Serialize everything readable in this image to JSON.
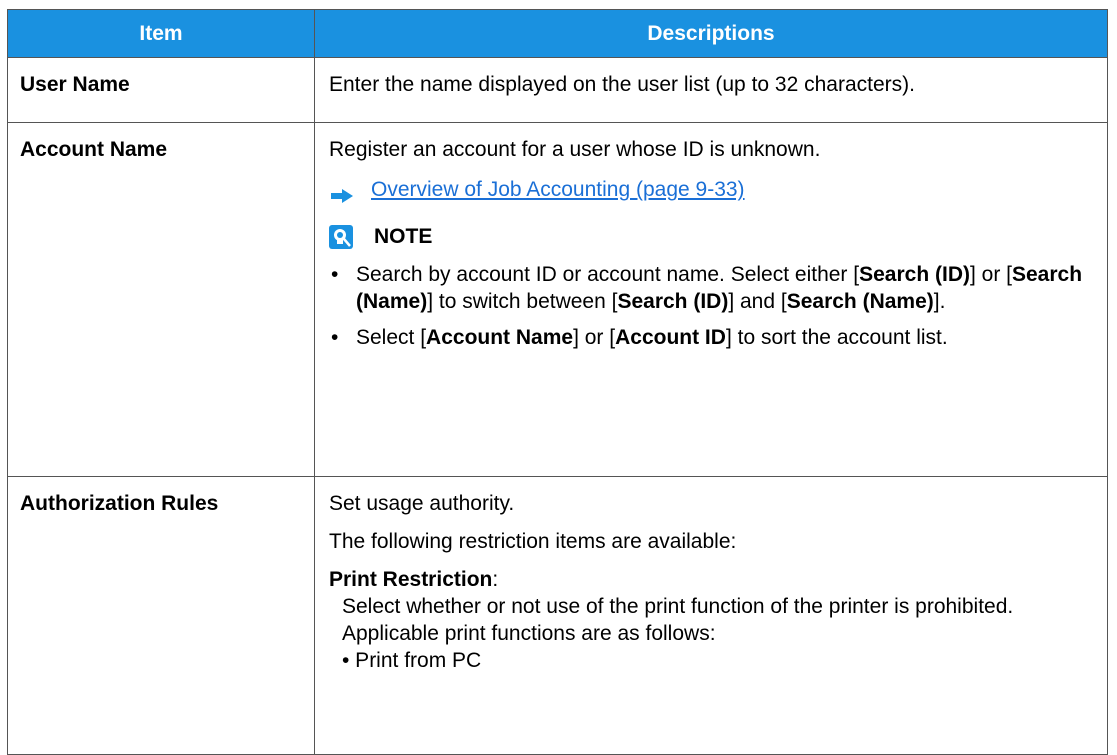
{
  "table": {
    "header": {
      "item": "Item",
      "descriptions": "Descriptions"
    },
    "rows": [
      {
        "item": "User Name",
        "text": "Enter the name displayed on the user list (up to 32 characters)."
      },
      {
        "item": "Account Name",
        "text": "Register an account for a user whose ID is unknown.",
        "link": "Overview of Job Accounting (page 9-33)",
        "note_title": "NOTE",
        "bullet_glyph": "•",
        "bullet1": {
          "part1": "Search by account ID or account name. Select either [",
          "bold1": "Search (ID)",
          "part2": "] or [",
          "bold2": "Search (Name)",
          "part3": "] to switch between [",
          "bold3": "Search (ID)",
          "part4": "] and [",
          "bold4": "Search (Name)",
          "part5": "]."
        },
        "bullet2": {
          "part1": "Select [",
          "bold1": "Account Name",
          "part2": "] or [",
          "bold2": "Account ID",
          "part3": "] to sort the account list."
        }
      },
      {
        "item": "Authorization Rules",
        "line1": "Set usage authority.",
        "line2": "The following restriction items are available:",
        "restriction_title": "Print Restriction",
        "restriction_colon": ":",
        "restriction_desc": "Select whether or not use of the print function of the printer is prohibited.",
        "applicable": "Applicable print functions are as follows:",
        "function1": "• Print from PC"
      }
    ]
  },
  "colors": {
    "header_bg": "#1a91e0",
    "link": "#1a6fd6",
    "arrow": "#1a91e0",
    "border": "#555555"
  },
  "icons": {
    "link_arrow": "right-arrow-icon",
    "note": "lightbulb-note-icon"
  }
}
